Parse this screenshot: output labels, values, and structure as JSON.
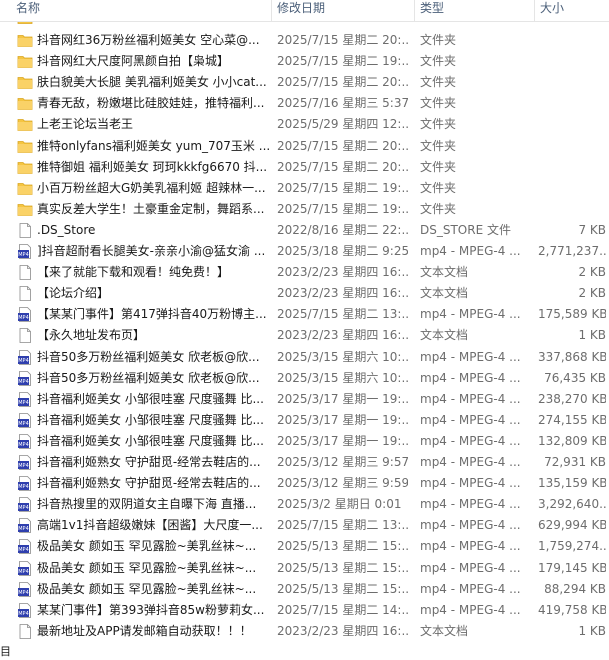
{
  "columns": {
    "name": "名称",
    "date": "修改日期",
    "type": "类型",
    "size": "大小"
  },
  "rows": [
    {
      "kind": "folder",
      "name": "抖音网红36万粉丝福利姬美女 空心菜@...",
      "date": "2025/7/15 星期二 20:...",
      "type": "文件夹",
      "size": ""
    },
    {
      "kind": "folder",
      "name": "抖音网红大尺度阿黑颜自拍【枭城】",
      "date": "2025/7/15 星期二 19:...",
      "type": "文件夹",
      "size": ""
    },
    {
      "kind": "folder",
      "name": "肤白貌美大长腿 美乳福利姬美女 小小cat...",
      "date": "2025/7/15 星期二 20:...",
      "type": "文件夹",
      "size": ""
    },
    {
      "kind": "folder",
      "name": "青春无敌，粉嫩堪比硅胶娃娃，推特福利...",
      "date": "2025/7/16 星期三 5:37",
      "type": "文件夹",
      "size": ""
    },
    {
      "kind": "folder",
      "name": "上老王论坛当老王",
      "date": "2025/5/29 星期四 12:...",
      "type": "文件夹",
      "size": ""
    },
    {
      "kind": "folder",
      "name": "推特onlyfans福利姬美女 yum_707玉米 ...",
      "date": "2025/7/15 星期二 20:...",
      "type": "文件夹",
      "size": ""
    },
    {
      "kind": "folder",
      "name": "推特御姐 福利姬美女 珂珂kkkfg6670 抖...",
      "date": "2025/7/15 星期二 20:...",
      "type": "文件夹",
      "size": ""
    },
    {
      "kind": "folder",
      "name": "小百万粉丝超大G奶美乳福利姬 超辣林一...",
      "date": "2025/7/15 星期二 19:...",
      "type": "文件夹",
      "size": ""
    },
    {
      "kind": "folder",
      "name": "真实反差大学生！土豪重金定制，舞蹈系...",
      "date": "2025/7/15 星期二 19:...",
      "type": "文件夹",
      "size": ""
    },
    {
      "kind": "file",
      "name": ".DS_Store",
      "date": "2022/8/16 星期二 22:...",
      "type": "DS_STORE 文件",
      "size": "7 KB"
    },
    {
      "kind": "video",
      "name": "]抖音超耐看长腿美女-亲亲小渝@猛女渝 ...",
      "date": "2025/3/18 星期二 9:25",
      "type": "mp4 - MPEG-4 ...",
      "size": "2,771,237..."
    },
    {
      "kind": "file",
      "name": "【来了就能下载和观看！纯免费！】",
      "date": "2023/2/23 星期四 16:...",
      "type": "文本文档",
      "size": "2 KB"
    },
    {
      "kind": "file",
      "name": "【论坛介绍】",
      "date": "2023/2/23 星期四 16:...",
      "type": "文本文档",
      "size": "2 KB"
    },
    {
      "kind": "video",
      "name": "【某某门事件】第417弹抖音40万粉博主...",
      "date": "2025/7/15 星期二 13:...",
      "type": "mp4 - MPEG-4 ...",
      "size": "175,589 KB"
    },
    {
      "kind": "file",
      "name": "【永久地址发布页】",
      "date": "2023/2/23 星期四 16:...",
      "type": "文本文档",
      "size": "1 KB"
    },
    {
      "kind": "video",
      "name": "抖音50多万粉丝福利姬美女 欣老板@欣...",
      "date": "2025/3/15 星期六 10:...",
      "type": "mp4 - MPEG-4 ...",
      "size": "337,868 KB"
    },
    {
      "kind": "video",
      "name": "抖音50多万粉丝福利姬美女 欣老板@欣...",
      "date": "2025/3/15 星期六 10:...",
      "type": "mp4 - MPEG-4 ...",
      "size": "76,435 KB"
    },
    {
      "kind": "video",
      "name": "抖音福利姬美女 小邹很哇塞 尺度骚舞 比...",
      "date": "2025/3/17 星期一 19:...",
      "type": "mp4 - MPEG-4 ...",
      "size": "238,270 KB"
    },
    {
      "kind": "video",
      "name": "抖音福利姬美女 小邹很哇塞 尺度骚舞 比...",
      "date": "2025/3/17 星期一 19:...",
      "type": "mp4 - MPEG-4 ...",
      "size": "274,155 KB"
    },
    {
      "kind": "video",
      "name": "抖音福利姬美女 小邹很哇塞 尺度骚舞 比...",
      "date": "2025/3/17 星期一 19:...",
      "type": "mp4 - MPEG-4 ...",
      "size": "132,809 KB"
    },
    {
      "kind": "video",
      "name": "抖音福利姬熟女 守护甜觅-经常去鞋店的...",
      "date": "2025/3/12 星期三 9:57",
      "type": "mp4 - MPEG-4 ...",
      "size": "72,931 KB"
    },
    {
      "kind": "video",
      "name": "抖音福利姬熟女 守护甜觅-经常去鞋店的...",
      "date": "2025/3/12 星期三 9:59",
      "type": "mp4 - MPEG-4 ...",
      "size": "135,159 KB"
    },
    {
      "kind": "video",
      "name": "抖音热搜里的双阴道女主自曝下海 直播...",
      "date": "2025/3/2 星期日 0:01",
      "type": "mp4 - MPEG-4 ...",
      "size": "3,292,640..."
    },
    {
      "kind": "video",
      "name": "高端1v1抖音超级嫩妹【困酱】大尺度一...",
      "date": "2025/7/15 星期二 13:...",
      "type": "mp4 - MPEG-4 ...",
      "size": "629,994 KB"
    },
    {
      "kind": "video",
      "name": "极品美女 颜如玉 罕见露脸~美乳丝袜~...",
      "date": "2025/5/13 星期二 15:...",
      "type": "mp4 - MPEG-4 ...",
      "size": "1,759,274..."
    },
    {
      "kind": "video",
      "name": "极品美女 颜如玉 罕见露脸~美乳丝袜~...",
      "date": "2025/5/13 星期二 15:...",
      "type": "mp4 - MPEG-4 ...",
      "size": "179,145 KB"
    },
    {
      "kind": "video",
      "name": "极品美女 颜如玉 罕见露脸~美乳丝袜~...",
      "date": "2025/5/13 星期二 15:...",
      "type": "mp4 - MPEG-4 ...",
      "size": "88,294 KB"
    },
    {
      "kind": "video",
      "name": "某某门事件】第393弹抖音85w粉萝莉女...",
      "date": "2025/7/15 星期二 14:...",
      "type": "mp4 - MPEG-4 ...",
      "size": "419,758 KB"
    },
    {
      "kind": "file",
      "name": "最新地址及APP请发邮箱自动获取！！！",
      "date": "2023/2/23 星期四 16:...",
      "type": "文本文档",
      "size": "1 KB"
    }
  ],
  "status": {
    "text": "目"
  },
  "icons": {
    "folder": "folder-icon",
    "video": "video-file-icon",
    "file": "document-icon"
  },
  "colors": {
    "folder": "#f5c542",
    "video_badge": "#2f3fae",
    "header_text": "#4c607a",
    "secondary_text": "#6d6d6d"
  }
}
